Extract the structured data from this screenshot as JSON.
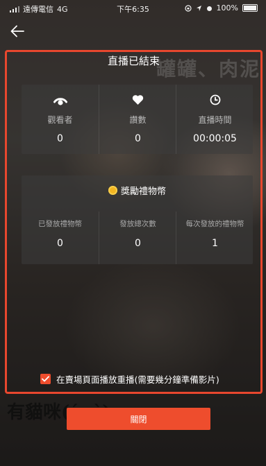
{
  "status_bar": {
    "carrier": "遠傳電信",
    "network": "4G",
    "time": "下午6:35",
    "battery": "100%"
  },
  "background": {
    "top_text": "罐罐、肉泥",
    "bottom_text": "有貓咪(ˊ‿ˋ)"
  },
  "dialog": {
    "title": "直播已結束",
    "stats": [
      {
        "icon": "eye-icon",
        "label": "觀看者",
        "value": "0"
      },
      {
        "icon": "heart-icon",
        "label": "讚數",
        "value": "0"
      },
      {
        "icon": "clock-icon",
        "label": "直播時間",
        "value": "00:00:05"
      }
    ],
    "gift_section": {
      "icon": "coin-icon",
      "title": "獎勵禮物幣",
      "items": [
        {
          "label": "已發放禮物幣",
          "value": "0"
        },
        {
          "label": "發放總次數",
          "value": "0"
        },
        {
          "label": "每次發放的禮物幣",
          "value": "1"
        }
      ]
    },
    "replay_checkbox": {
      "checked": true,
      "label": "在賣場頁面播放重播(需要幾分鐘準備影片)"
    }
  },
  "close_button": {
    "label": "關閉"
  },
  "colors": {
    "accent": "#ee4d2d",
    "highlight_border": "#e8472e",
    "coin": "#f3b521"
  }
}
